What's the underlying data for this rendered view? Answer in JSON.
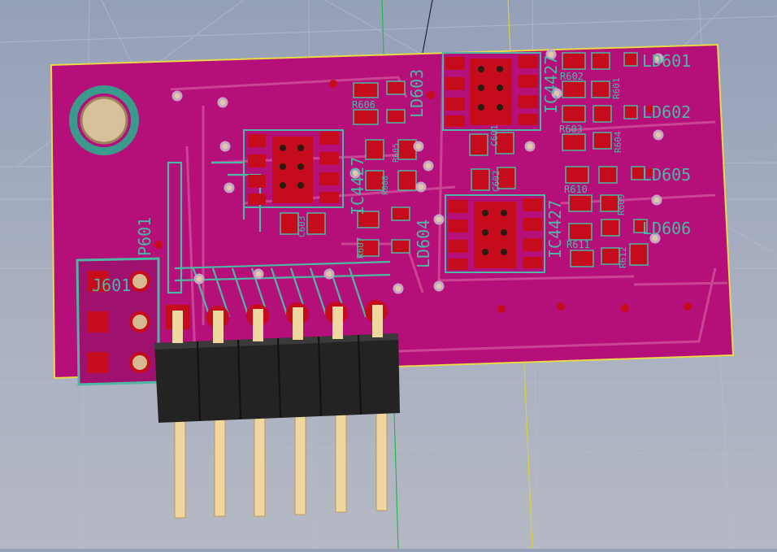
{
  "viewer": {
    "mode": "3D board view",
    "colors": {
      "background_top": "#95a0b9",
      "background_bottom": "#b5b9c3",
      "soldermask": "#b5107a",
      "silkscreen": "#4fb6a5",
      "copper_pad": "#c40c1c",
      "outline": "#e6d84a",
      "header_body": "#232323",
      "header_pin": "#f0d7a0"
    }
  },
  "board": {
    "ic_refs": [
      "IC4427",
      "IC4427",
      "IC4427"
    ],
    "led_refs": [
      "LD601",
      "LD602",
      "LD603",
      "LD604",
      "LD605",
      "LD606"
    ],
    "resistor_refs": [
      "R602",
      "R601",
      "R603",
      "R604",
      "R605",
      "R606",
      "R607",
      "R608",
      "R609",
      "R610",
      "R611",
      "R612"
    ],
    "capacitor_refs": [
      "C601",
      "C602",
      "C603"
    ],
    "connector_refs": [
      "J601",
      "P601"
    ],
    "header_pin_count": 6
  }
}
